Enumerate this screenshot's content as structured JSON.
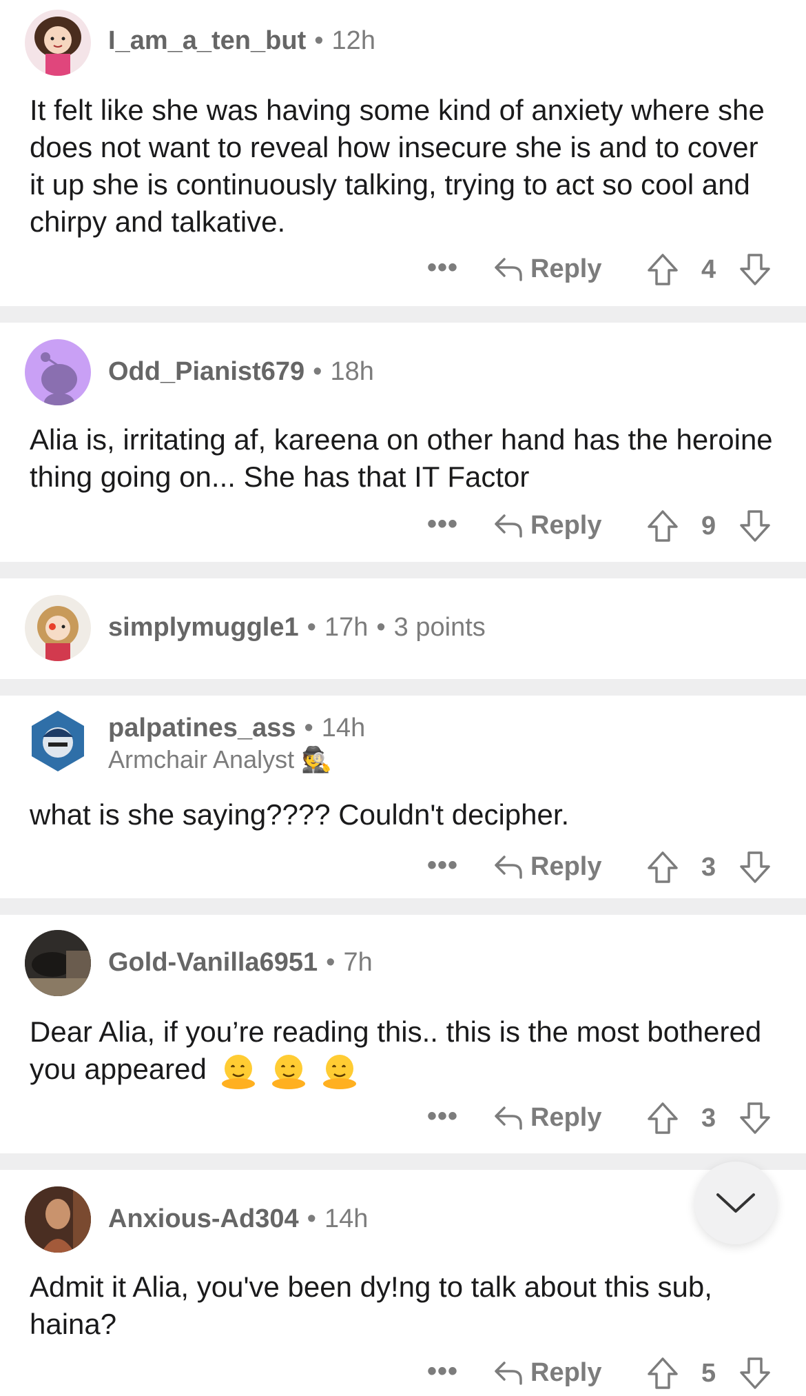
{
  "comments": [
    {
      "username": "I_am_a_ten_but",
      "time": "12h",
      "text": "It felt like she was having some kind of anxiety where she does not want to reveal how insecure she is and to cover it up she is continuously talking, trying to act so cool and chirpy and talkative.",
      "reply_label": "Reply",
      "votes": "4",
      "more": "•••"
    },
    {
      "username": "Odd_Pianist679",
      "time": "18h",
      "text": "Alia is, irritating af, kareena on other hand has the heroine thing going on... She has that IT Factor",
      "reply_label": "Reply",
      "votes": "9",
      "more": "•••"
    },
    {
      "username": "simplymuggle1",
      "time": "17h",
      "points": "3 points"
    },
    {
      "username": "palpatines_ass",
      "time": "14h",
      "flair": "Armchair Analyst 🕵",
      "text": "what is she saying???? Couldn't  decipher.",
      "reply_label": "Reply",
      "votes": "3",
      "more": "•••"
    },
    {
      "username": "Gold-Vanilla6951",
      "time": "7h",
      "text": "Dear Alia, if you’re reading this.. this is the most bothered you appeared",
      "emoji": [
        "melting-face",
        "melting-face",
        "melting-face"
      ],
      "reply_label": "Reply",
      "votes": "3",
      "more": "•••"
    },
    {
      "username": "Anxious-Ad304",
      "time": "14h",
      "text": "Admit it Alia, you've been dy!ng to talk about this sub, haina?",
      "reply_label": "Reply",
      "votes": "5",
      "more": "•••"
    }
  ],
  "colors": {
    "meta": "#7c7c7c",
    "separator": "#eeeeef",
    "avatar_purple": "#c9a0f5"
  },
  "icons": [
    "reply-arrow-icon",
    "upvote-arrow-icon",
    "downvote-arrow-icon",
    "chevron-down-icon",
    "more-dots-icon"
  ]
}
